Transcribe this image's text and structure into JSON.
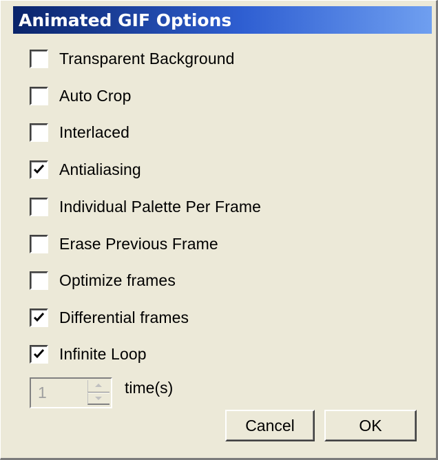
{
  "window": {
    "title": "Animated GIF Options"
  },
  "options": [
    {
      "label": "Transparent Background",
      "checked": false
    },
    {
      "label": "Auto Crop",
      "checked": false
    },
    {
      "label": "Interlaced",
      "checked": false
    },
    {
      "label": "Antialiasing",
      "checked": true
    },
    {
      "label": "Individual Palette Per Frame",
      "checked": false
    },
    {
      "label": "Erase Previous Frame",
      "checked": false
    },
    {
      "label": "Optimize frames",
      "checked": false
    },
    {
      "label": "Differential frames",
      "checked": true
    },
    {
      "label": "Infinite Loop",
      "checked": true
    }
  ],
  "loop_count": {
    "value": "1",
    "unit_label": "time(s)",
    "enabled": false
  },
  "buttons": {
    "cancel_label": "Cancel",
    "ok_label": "OK"
  },
  "colors": {
    "dialog_background": "#ece9d8",
    "title_gradient_start": "#0a246a",
    "title_gradient_end": "#6f9ff0",
    "title_text": "#ffffff",
    "disabled_text": "#a0a0a0"
  },
  "icons": {
    "check": "check-mark-icon",
    "spin_up": "spin-up-arrow-icon",
    "spin_down": "spin-down-arrow-icon"
  }
}
